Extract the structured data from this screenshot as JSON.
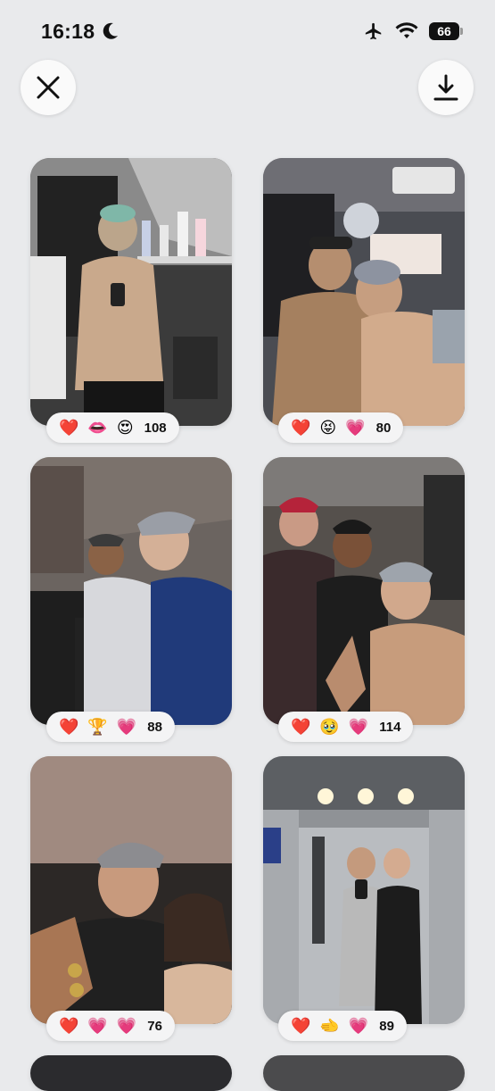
{
  "status": {
    "time": "16:18",
    "battery": "66"
  },
  "buttons": {
    "close_icon": "close-icon",
    "download_icon": "download-icon"
  },
  "posts": [
    {
      "reactions": [
        "❤️",
        "👄",
        "😍"
      ],
      "count": "108"
    },
    {
      "reactions": [
        "❤️",
        "😝",
        "💗"
      ],
      "count": "80"
    },
    {
      "reactions": [
        "❤️",
        "🏆",
        "💗"
      ],
      "count": "88"
    },
    {
      "reactions": [
        "❤️",
        "🥹",
        "💗"
      ],
      "count": "114"
    },
    {
      "reactions": [
        "❤️",
        "💗",
        "💗"
      ],
      "count": "76"
    },
    {
      "reactions": [
        "❤️",
        "🫲",
        "💗"
      ],
      "count": "89"
    }
  ]
}
